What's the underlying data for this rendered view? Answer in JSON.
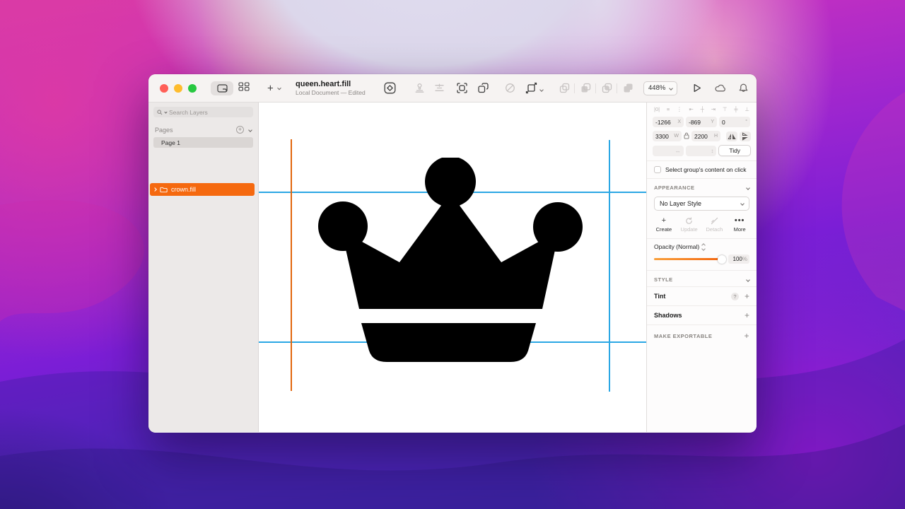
{
  "window": {
    "title": "queen.heart.fill",
    "subtitle": "Local Document — Edited",
    "zoom_level": "448%"
  },
  "sidebar": {
    "search_placeholder": "Search Layers",
    "pages_header": "Pages",
    "pages": [
      {
        "name": "Page 1"
      }
    ],
    "layers": [
      {
        "name": "crown.fill"
      }
    ]
  },
  "inspector": {
    "align_icons": [
      "|0|",
      "≡",
      "⋮",
      "⇤",
      "┼",
      "⇥",
      "⊤",
      "╪",
      "⊥"
    ],
    "x_value": "-1266",
    "x_label": "X",
    "y_value": "-869",
    "y_label": "Y",
    "rotation_value": "0",
    "rotation_unit": "°",
    "width_value": "3300",
    "width_label": "W",
    "height_value": "2200",
    "height_label": "H",
    "resize_h_icon": "↔",
    "resize_v_icon": "↕",
    "tidy_label": "Tidy",
    "group_content_label": "Select group's content on click",
    "appearance_header": "APPEARANCE",
    "layer_style_value": "No Layer Style",
    "create_label": "Create",
    "update_label": "Update",
    "detach_label": "Detach",
    "more_label": "More",
    "opacity_label": "Opacity (Normal)",
    "opacity_value": "100",
    "opacity_unit": "%",
    "style_header": "STYLE",
    "tint_label": "Tint",
    "shadows_label": "Shadows",
    "exportable_header": "MAKE EXPORTABLE"
  },
  "icons": {
    "plus": "+",
    "add": "+",
    "more_dots": "•••",
    "help": "?"
  },
  "colors": {
    "selection_orange": "#F5690F",
    "guide_blue": "#2BA7E4",
    "guide_orange": "#E2660C",
    "slider_orange": "#F3640E",
    "traffic_red": "#FF5F57",
    "traffic_yellow": "#FEBC2E",
    "traffic_green": "#28C841"
  }
}
